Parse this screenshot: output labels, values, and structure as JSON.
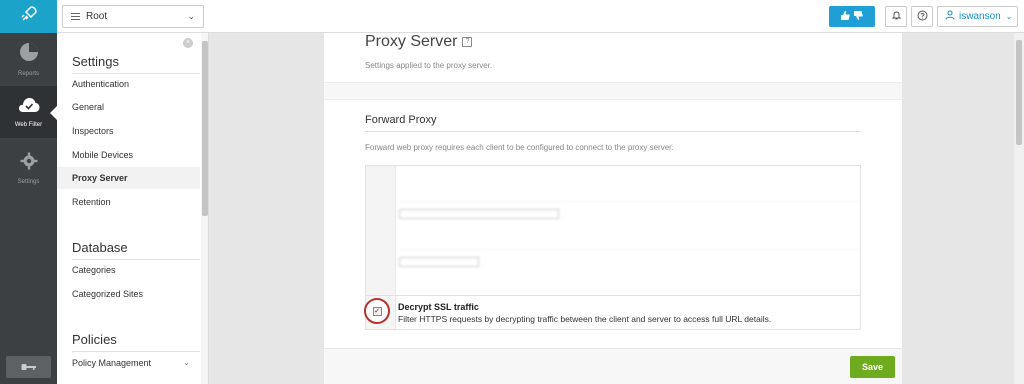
{
  "topbar": {
    "root_label": "Root",
    "username": "iswanson"
  },
  "leftnav": {
    "items": [
      {
        "label": "Reports",
        "icon": "pie-chart-icon"
      },
      {
        "label": "Web Filter",
        "icon": "cloud-icon"
      },
      {
        "label": "Settings",
        "icon": "gear-icon"
      }
    ]
  },
  "settings_panel": {
    "sections": [
      {
        "title": "Settings",
        "items": [
          "Authentication",
          "General",
          "Inspectors",
          "Mobile Devices",
          "Proxy Server",
          "Retention"
        ]
      },
      {
        "title": "Database",
        "items": [
          "Categories",
          "Categorized Sites"
        ]
      },
      {
        "title": "Policies",
        "items": [
          "Policy Management"
        ]
      }
    ],
    "active_item": "Proxy Server"
  },
  "main": {
    "title": "Proxy Server",
    "help_glyph": "?",
    "subtitle": "Settings applied to the proxy server.",
    "forward_proxy": {
      "title": "Forward Proxy",
      "description": "Forward web proxy requires each client to be configured to connect to the proxy server.",
      "ssl": {
        "label": "Decrypt SSL traffic",
        "description": "Filter HTTPS requests by decrypting traffic between the client and server to access full URL details.",
        "checked": true
      }
    },
    "save_label": "Save"
  },
  "colors": {
    "accent": "#1ba3c9",
    "nav_bg": "#3c4043",
    "save_green": "#6eab1f",
    "highlight_ring": "#b8312f"
  }
}
